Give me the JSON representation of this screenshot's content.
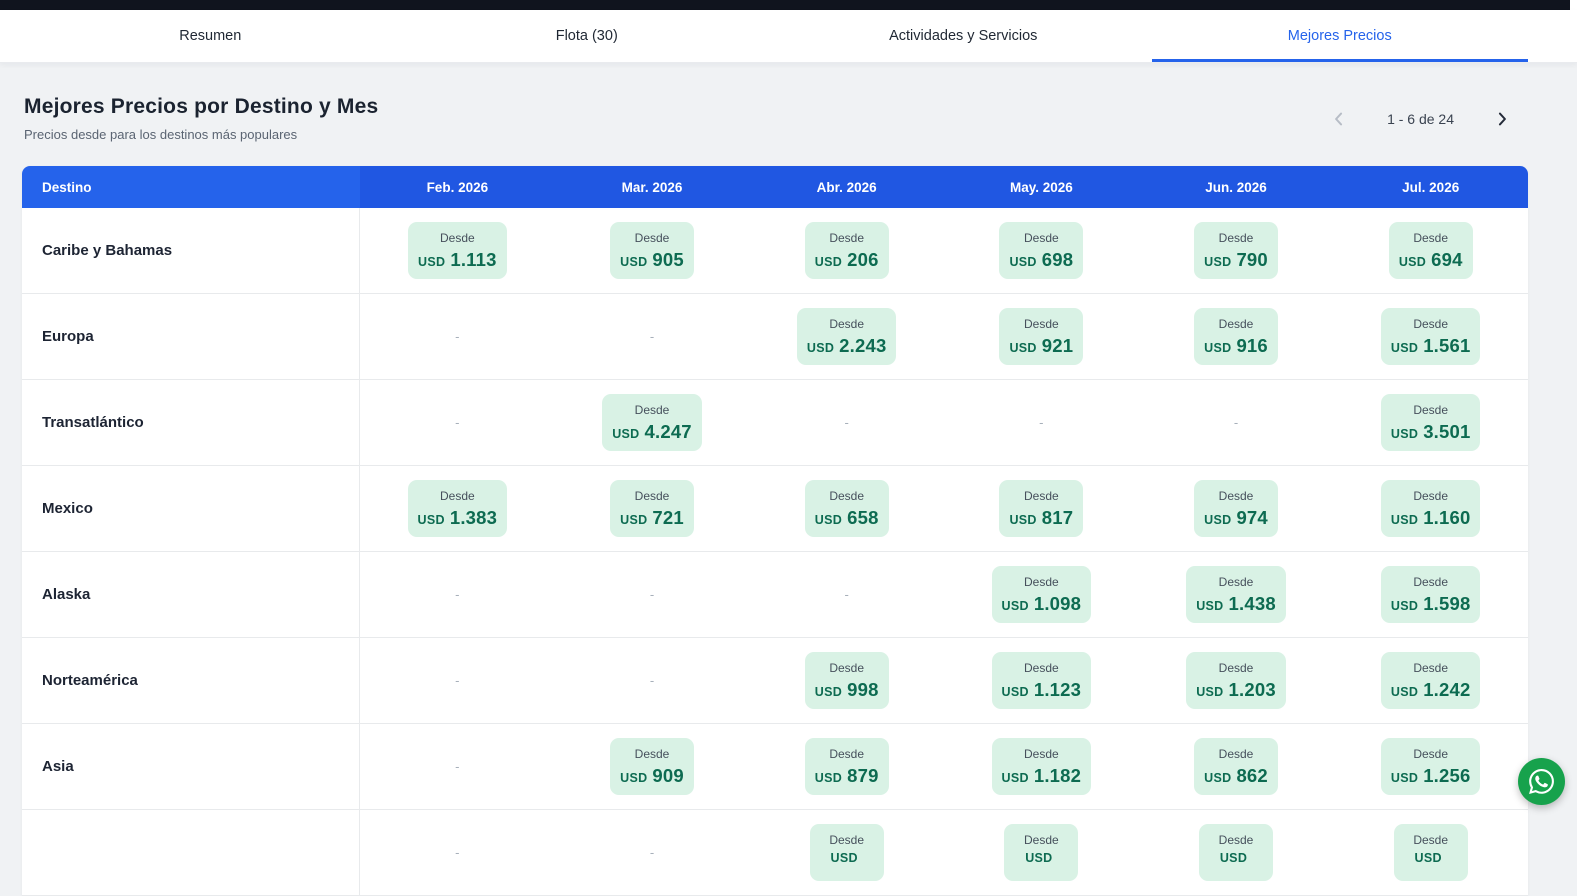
{
  "topnav": {
    "tabs": [
      {
        "id": "resumen",
        "label": "Resumen",
        "active": false
      },
      {
        "id": "flota",
        "label": "Flota (30)",
        "active": false
      },
      {
        "id": "actividades-y-servicios",
        "label": "Actividades y Servicios",
        "active": false
      },
      {
        "id": "mejores-precios",
        "label": "Mejores Precios",
        "active": true
      }
    ]
  },
  "header": {
    "title": "Mejores Precios por Destino y Mes",
    "subtitle": "Precios desde para los destinos más populares",
    "pagination": {
      "label": "1 - 6 de 24"
    }
  },
  "table": {
    "destination_header": "Destino",
    "months": [
      "Feb. 2026",
      "Mar. 2026",
      "Abr. 2026",
      "May. 2026",
      "Jun. 2026",
      "Jul. 2026"
    ],
    "price_prefix": "Desde",
    "currency": "USD",
    "no_price_placeholder": "-",
    "rows": [
      {
        "destination": "Caribe y Bahamas",
        "prices": [
          "1.113",
          "905",
          "206",
          "698",
          "790",
          "694"
        ]
      },
      {
        "destination": "Europa",
        "prices": [
          null,
          null,
          "2.243",
          "921",
          "916",
          "1.561"
        ]
      },
      {
        "destination": "Transatlántico",
        "prices": [
          null,
          "4.247",
          null,
          null,
          null,
          "3.501"
        ]
      },
      {
        "destination": "Mexico",
        "prices": [
          "1.383",
          "721",
          "658",
          "817",
          "974",
          "1.160"
        ]
      },
      {
        "destination": "Alaska",
        "prices": [
          null,
          null,
          null,
          "1.098",
          "1.438",
          "1.598"
        ]
      },
      {
        "destination": "Norteamérica",
        "prices": [
          null,
          null,
          "998",
          "1.123",
          "1.203",
          "1.242"
        ]
      },
      {
        "destination": "Asia",
        "prices": [
          null,
          "909",
          "879",
          "1.182",
          "862",
          "1.256"
        ]
      },
      {
        "destination": "",
        "prices": [
          null,
          null,
          "",
          "",
          "",
          ""
        ]
      }
    ]
  },
  "colors": {
    "accent_blue": "#2563eb",
    "table_header_blue": "#2057e2",
    "chip_background": "#d9f2e5",
    "chip_text_green": "#0d6b51",
    "whatsapp_green": "#17a24c",
    "top_bar_dark": "#10141e",
    "page_background": "#f0f2f4"
  }
}
